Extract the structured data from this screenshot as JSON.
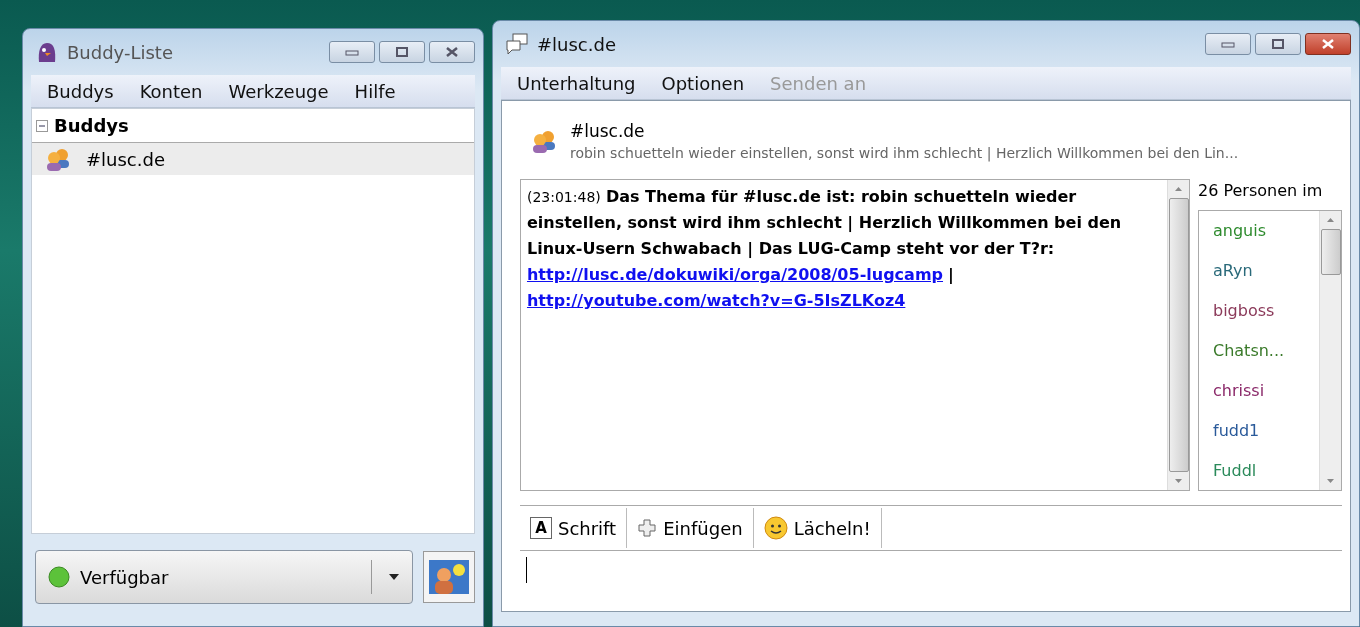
{
  "buddy_window": {
    "title": "Buddy-Liste",
    "menu": [
      {
        "label": "Buddys",
        "disabled": false
      },
      {
        "label": "Konten",
        "disabled": false
      },
      {
        "label": "Werkzeuge",
        "disabled": false
      },
      {
        "label": "Hilfe",
        "disabled": false
      }
    ],
    "groups": [
      {
        "label": "Buddys",
        "expanded": true,
        "children": [
          {
            "label": "#lusc.de",
            "selected": true
          }
        ]
      }
    ],
    "status": {
      "label": "Verfügbar"
    }
  },
  "chat_window": {
    "title": "#lusc.de",
    "menu": [
      {
        "label": "Unterhaltung",
        "disabled": false
      },
      {
        "label": "Optionen",
        "disabled": false
      },
      {
        "label": "Senden an",
        "disabled": true
      }
    ],
    "header": {
      "name": "#lusc.de",
      "topic": "robin schuetteln wieder einstellen, sonst wird ihm schlecht | Herzlich Willkommen bei den Lin..."
    },
    "messages": [
      {
        "parts": [
          {
            "kind": "timestamp",
            "text": "(23:01:48)"
          },
          {
            "kind": "text",
            "text": "Das Thema für #lusc.de ist: robin schuetteln wieder einstellen, sonst wird ihm schlecht | Herzlich Willkommen bei den Linux-Usern Schwabach | Das LUG-Camp steht vor der T?r:"
          },
          {
            "kind": "link",
            "text": "http://lusc.de/dokuwiki/orga/2008/05-lugcamp"
          },
          {
            "kind": "text",
            "text": "|"
          },
          {
            "kind": "link",
            "text": "http://youtube.com/watch?v=G-5IsZLKoz4"
          }
        ]
      }
    ],
    "users_heading": "26 Personen im",
    "users": [
      {
        "name": "anguis",
        "color": "#2e8b2e"
      },
      {
        "name": "aRyn",
        "color": "#2a6a7a"
      },
      {
        "name": "bigboss",
        "color": "#8b3a5a"
      },
      {
        "name": "Chatsn...",
        "color": "#3a7a2a"
      },
      {
        "name": "chrissi",
        "color": "#8b2a6a"
      },
      {
        "name": "fudd1",
        "color": "#2a5a9a"
      },
      {
        "name": "Fuddl",
        "color": "#2a8a5a"
      }
    ],
    "toolbar": [
      {
        "kind": "font",
        "glyph": "A",
        "label": "Schrift"
      },
      {
        "kind": "insert",
        "label": "Einfügen"
      },
      {
        "kind": "smile",
        "label": "Lächeln!"
      }
    ]
  }
}
